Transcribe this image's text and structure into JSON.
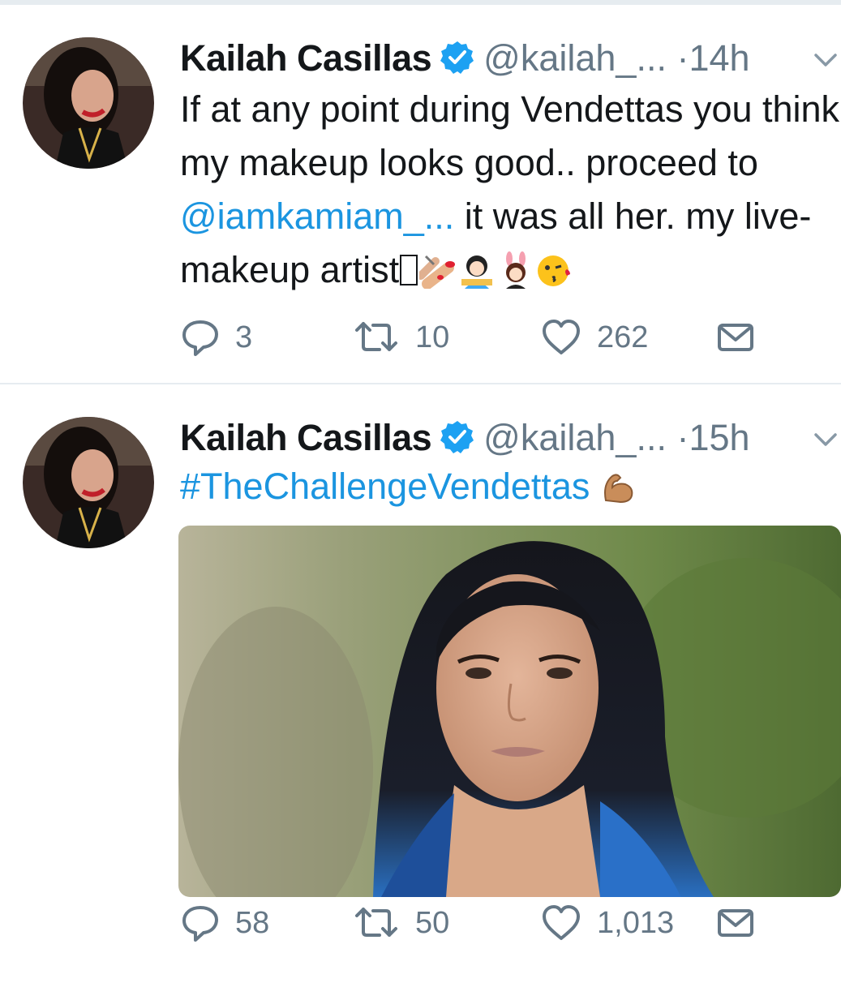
{
  "tweets": [
    {
      "name": "Kailah Casillas",
      "handle": "@kailah_...",
      "dot": "·",
      "time": "14h",
      "text_parts": {
        "a": "If at any point during Vendettas you think my makeup looks good.. proceed to ",
        "mention": "@iamkamiam_...",
        "b": " it was all her. my live-makeup artist",
        "glyph": "💅"
      },
      "emojis": [
        "nail-polish-icon",
        "woman-getting-makeup-icon",
        "bunny-girl-icon",
        "kiss-face-icon"
      ],
      "stats": {
        "replies": "3",
        "retweets": "10",
        "likes": "262"
      }
    },
    {
      "name": "Kailah Casillas",
      "handle": "@kailah_...",
      "dot": "·",
      "time": "15h",
      "hashtag": "#TheChallengeVendettas",
      "emojis": [
        "flexed-biceps-icon"
      ],
      "stats": {
        "replies": "58",
        "retweets": "50",
        "likes": "1,013"
      }
    }
  ],
  "colors": {
    "link": "#1b95e0",
    "verified": "#1da1f2",
    "muted": "#657786",
    "text": "#14171a"
  }
}
